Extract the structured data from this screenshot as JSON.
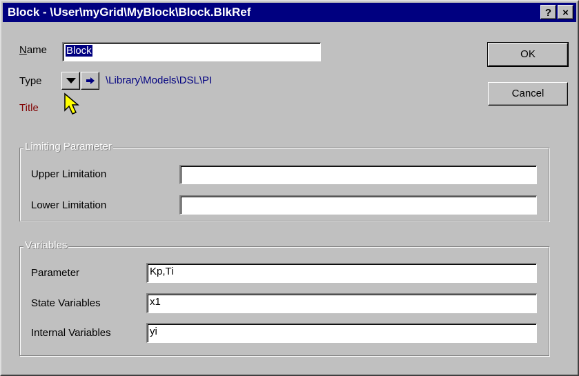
{
  "window": {
    "title": "Block - \\User\\myGrid\\MyBlock\\Block.BlkRef",
    "help_label": "?",
    "close_label": "×"
  },
  "name": {
    "label_prefix": "N",
    "label_rest": "ame",
    "value": "Block"
  },
  "type": {
    "label": "Type",
    "path": "\\Library\\Models\\DSL\\PI"
  },
  "title_label": "Title",
  "buttons": {
    "ok": "OK",
    "cancel": "Cancel"
  },
  "limiting": {
    "title": "Limiting Parameter",
    "upper_label": "Upper Limitation",
    "upper_value": "",
    "lower_label": "Lower Limitation",
    "lower_value": ""
  },
  "variables": {
    "title": "Variables",
    "parameter_label": "Parameter",
    "parameter_value": "Kp,Ti",
    "state_label": "State Variables",
    "state_value": "x1",
    "internal_label": "Internal Variables",
    "internal_value": "yi"
  },
  "colors": {
    "titlebar": "#000080",
    "face": "#c0c0c0",
    "path_text": "#000080",
    "title_label_text": "#800000"
  }
}
